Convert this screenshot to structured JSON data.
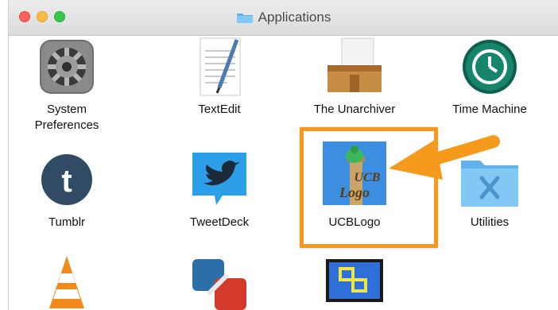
{
  "window": {
    "title": "Applications",
    "title_icon": "folder-icon"
  },
  "apps": [
    {
      "id": "system-preferences",
      "label": "System\nPreferences",
      "icon": "gear-icon"
    },
    {
      "id": "textedit",
      "label": "TextEdit",
      "icon": "textedit-icon"
    },
    {
      "id": "the-unarchiver",
      "label": "The Unarchiver",
      "icon": "unarchiver-box-icon"
    },
    {
      "id": "time-machine",
      "label": "Time Machine",
      "icon": "time-machine-icon"
    },
    {
      "id": "tumblr",
      "label": "Tumblr",
      "icon": "tumblr-icon"
    },
    {
      "id": "tweetdeck",
      "label": "TweetDeck",
      "icon": "tweetdeck-bird-icon"
    },
    {
      "id": "ucblogo",
      "label": "UCBLogo",
      "icon": "ucblogo-turtle-icon",
      "icon_text": [
        "UCB",
        "Logo"
      ]
    },
    {
      "id": "utilities",
      "label": "Utilities",
      "icon": "utilities-folder-icon"
    },
    {
      "id": "vlc",
      "label": "",
      "icon": "vlc-cone-icon"
    },
    {
      "id": "vmware-fusion",
      "label": "",
      "icon": "vmware-icon"
    },
    {
      "id": "remote-desktop",
      "label": "",
      "icon": "remote-desktop-icon"
    }
  ],
  "annotation": {
    "highlight_color": "#f59a1d",
    "arrow_color": "#f59a1d",
    "target": "UCBLogo"
  }
}
